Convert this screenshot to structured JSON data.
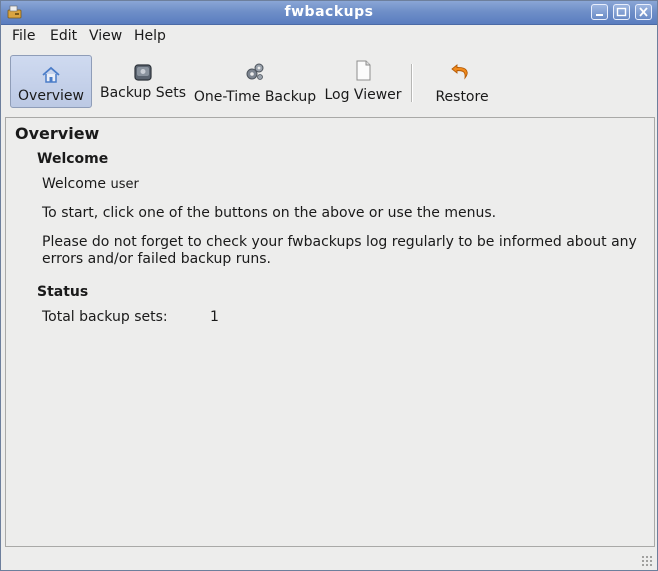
{
  "window": {
    "title": "fwbackups"
  },
  "menubar": {
    "items": [
      "File",
      "Edit",
      "View",
      "Help"
    ]
  },
  "toolbar": {
    "buttons": [
      {
        "label": "Overview",
        "icon": "home-icon",
        "active": true
      },
      {
        "label": "Backup Sets",
        "icon": "hard-drive-icon",
        "active": false
      },
      {
        "label": "One-Time Backup",
        "icon": "gears-icon",
        "active": false
      },
      {
        "label": "Log Viewer",
        "icon": "document-icon",
        "active": false
      },
      {
        "label": "Restore",
        "icon": "undo-arrow-icon",
        "active": false
      }
    ]
  },
  "overview": {
    "title": "Overview",
    "welcome_heading": "Welcome",
    "welcome_prefix": "Welcome",
    "username": "user",
    "start_text": "To start, click one of the buttons on the above or use the menus.",
    "log_reminder_line1": "Please do not forget to check your fwbackups log regularly to be informed about any",
    "log_reminder_line2": "errors and/or failed backup runs.",
    "status_heading": "Status",
    "total_sets_label": "Total backup sets:",
    "total_sets_value": "1"
  },
  "colors": {
    "titlebar": "#6f8fc8",
    "active_button": "#c4d1ea",
    "restore_arrow": "#f08a1c"
  }
}
